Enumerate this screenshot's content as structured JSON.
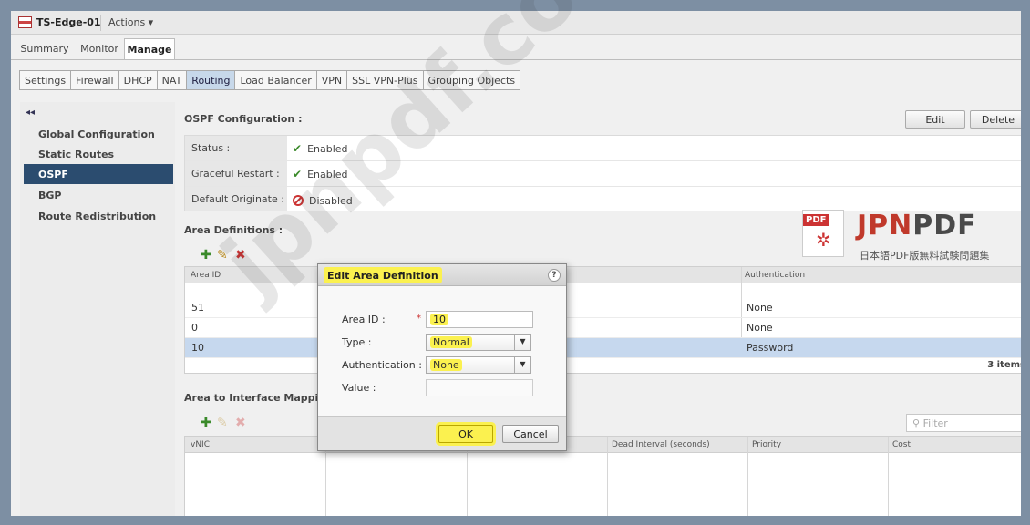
{
  "header": {
    "edge_name": "TS-Edge-01",
    "actions_label": "Actions ▾"
  },
  "tabs": [
    {
      "label": "Summary"
    },
    {
      "label": "Monitor"
    },
    {
      "label": "Manage"
    }
  ],
  "subtabs": [
    {
      "label": "Settings"
    },
    {
      "label": "Firewall"
    },
    {
      "label": "DHCP"
    },
    {
      "label": "NAT"
    },
    {
      "label": "Routing"
    },
    {
      "label": "Load Balancer"
    },
    {
      "label": "VPN"
    },
    {
      "label": "SSL VPN-Plus"
    },
    {
      "label": "Grouping Objects"
    }
  ],
  "sidebar": {
    "collapse_label": "◂◂",
    "items": [
      {
        "label": "Global Configuration"
      },
      {
        "label": "Static Routes"
      },
      {
        "label": "OSPF"
      },
      {
        "label": "BGP"
      },
      {
        "label": "Route Redistribution"
      }
    ]
  },
  "ospf": {
    "title": "OSPF Configuration :",
    "edit_label": "Edit",
    "delete_label": "Delete",
    "rows": [
      {
        "label": "Status :",
        "value": "Enabled"
      },
      {
        "label": "Graceful Restart :",
        "value": "Enabled"
      },
      {
        "label": "Default Originate :",
        "value": "Disabled"
      }
    ]
  },
  "areas": {
    "title": "Area Definitions :",
    "columns": {
      "area_id": "Area ID",
      "authentication": "Authentication"
    },
    "rows": [
      {
        "area_id": "51",
        "authentication": "None"
      },
      {
        "area_id": "0",
        "authentication": "None"
      },
      {
        "area_id": "10",
        "authentication": "Password"
      }
    ],
    "footer": "3 items"
  },
  "mapping": {
    "title": "Area to Interface Mapping :",
    "filter_placeholder": "Filter",
    "columns": {
      "vnic": "vNIC",
      "dead_interval": "Dead Interval (seconds)",
      "priority": "Priority",
      "cost": "Cost"
    }
  },
  "watermark": {
    "text": "jpnpdf.com",
    "brand_jpn": "JPN",
    "brand_pdf": "PDF",
    "pdf_tag": "PDF",
    "subtitle": "日本語PDF版無料試験問題集"
  },
  "dialog": {
    "title": "Edit Area Definition",
    "help": "?",
    "area_id_label": "Area ID :",
    "required_mark": "*",
    "area_id_value": "10",
    "type_label": "Type :",
    "type_value": "Normal",
    "auth_label": "Authentication :",
    "auth_value": "None",
    "value_label": "Value :",
    "ok_label": "OK",
    "cancel_label": "Cancel"
  }
}
